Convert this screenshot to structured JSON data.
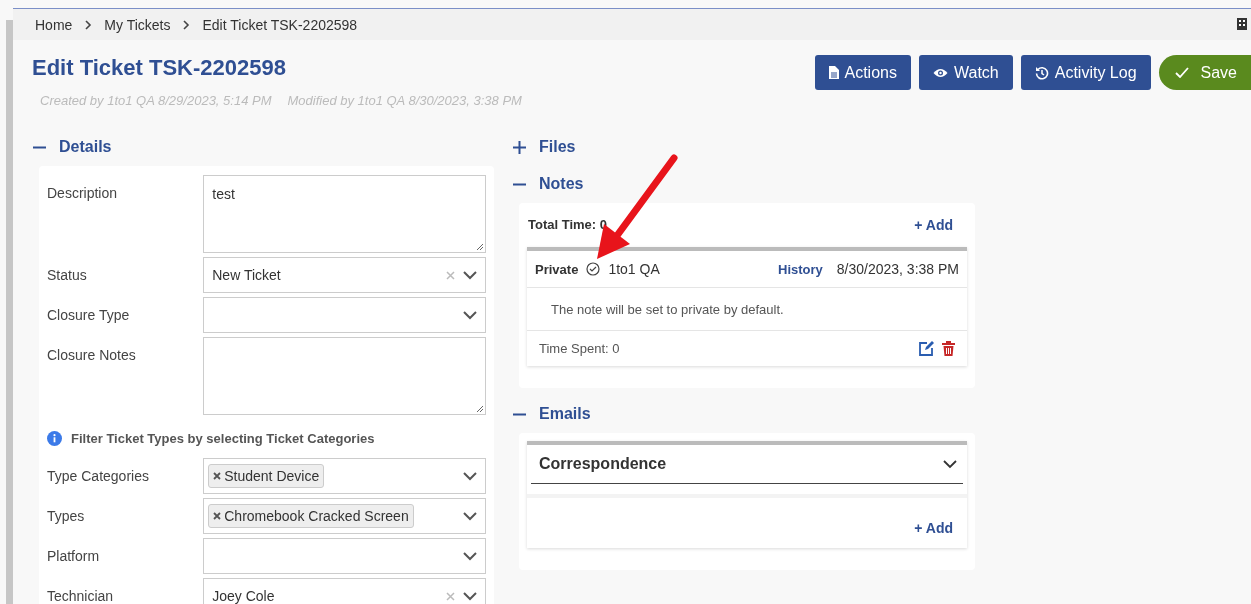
{
  "breadcrumb": [
    "Home",
    "My Tickets",
    "Edit Ticket TSK-2202598"
  ],
  "title": "Edit Ticket TSK-2202598",
  "meta": [
    "Created by 1to1 QA 8/29/2023, 5:14 PM",
    "Modified by 1to1 QA 8/30/2023, 3:38 PM"
  ],
  "actions": [
    {
      "label": "Actions",
      "kind": "document"
    },
    {
      "label": "Watch",
      "kind": "eye"
    },
    {
      "label": "Activity Log",
      "kind": "history"
    },
    {
      "label": "Save",
      "kind": "save"
    }
  ],
  "details": {
    "title": "Details",
    "expanded": true,
    "fields": [
      {
        "kind": "textarea",
        "label": "Description",
        "value": "test"
      },
      {
        "kind": "select",
        "label": "Status",
        "value": "New Ticket",
        "clearable": true
      },
      {
        "kind": "select",
        "label": "Closure Type",
        "clearable": false
      },
      {
        "kind": "textarea",
        "label": "Closure Notes"
      },
      {
        "kind": "info",
        "label": "Filter Ticket Types by selecting Ticket Categories"
      },
      {
        "kind": "tags",
        "label": "Type Categories",
        "tags": [
          "Student Device"
        ]
      },
      {
        "kind": "tags",
        "label": "Types",
        "tags": [
          "Chromebook Cracked Screen"
        ]
      },
      {
        "kind": "select",
        "label": "Platform",
        "clearable": false
      },
      {
        "kind": "select",
        "label": "Technician",
        "value": "Joey Cole",
        "clearable": true
      }
    ]
  },
  "files": {
    "title": "Files",
    "expanded": false
  },
  "notes": {
    "title": "Notes",
    "expanded": true,
    "total_time": "Total Time: 0",
    "add": "+ Add",
    "items": [
      {
        "visibility": "Private",
        "author": "1to1 QA",
        "history": "History",
        "date": "8/30/2023, 3:38 PM",
        "text": "The note will be set to private by default.",
        "time_spent": "Time Spent: 0"
      }
    ]
  },
  "emails": {
    "title": "Emails",
    "expanded": true,
    "panel": "Correspondence",
    "add": "+ Add"
  }
}
